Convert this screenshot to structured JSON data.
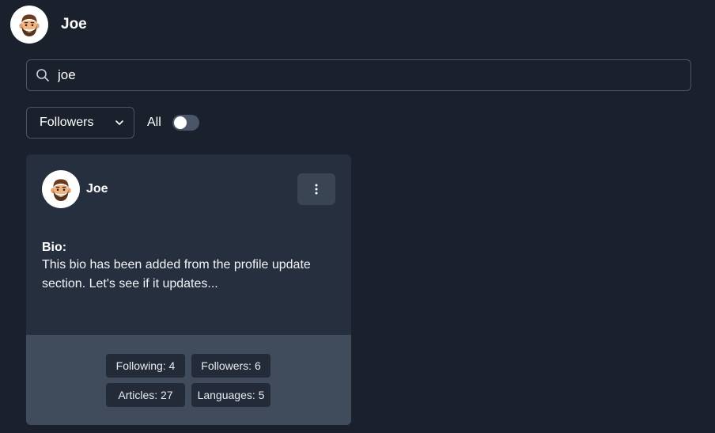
{
  "header": {
    "user_name": "Joe",
    "avatar_icon": "memoji-avatar-icon"
  },
  "search": {
    "value": "joe",
    "icon": "search-icon"
  },
  "filters": {
    "select_value": "Followers",
    "all_label": "All",
    "all_toggle_on": false
  },
  "card": {
    "name": "Joe",
    "bio_heading": "Bio:",
    "bio_text": "This bio has been added from the profile update section. Let's see if it updates...",
    "stats": {
      "following": "Following: 4",
      "followers": "Followers: 6",
      "articles": "Articles: 27",
      "languages": "Languages: 5"
    }
  },
  "colors": {
    "background": "#1a202c",
    "card": "#252f3e",
    "card_footer": "#404b5c",
    "badge": "#232b38",
    "border": "#4a5568"
  }
}
